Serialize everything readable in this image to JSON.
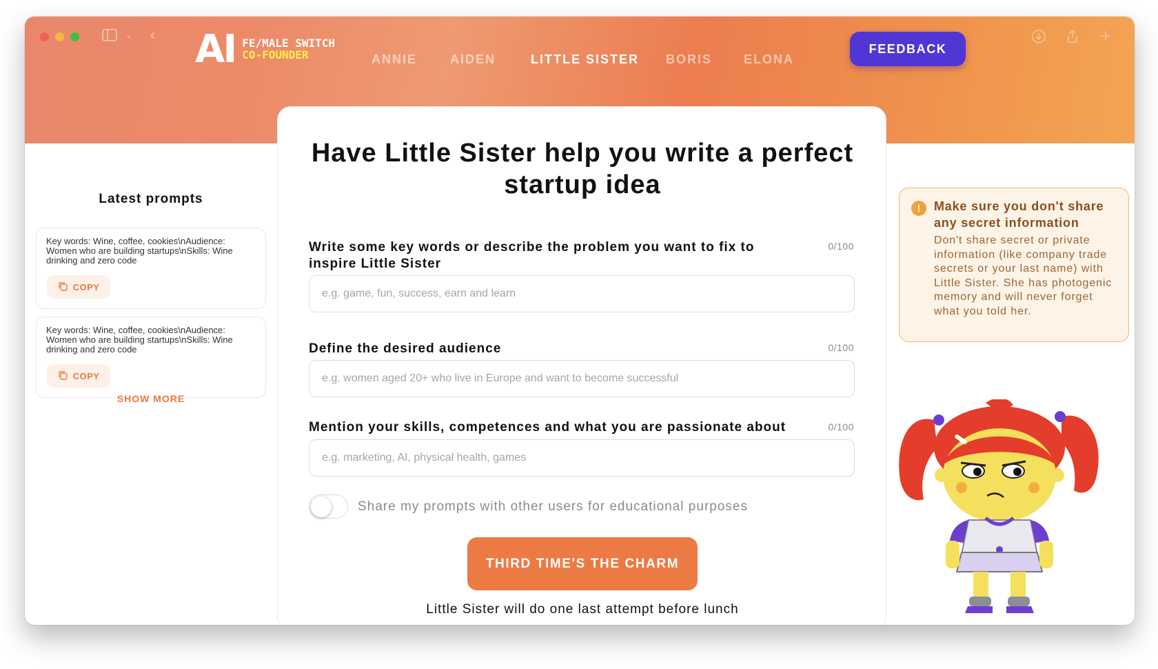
{
  "brand": {
    "logo_mark": "AI",
    "line1": "FE/MALE SWITCH",
    "line2": "CO-FOUNDER"
  },
  "nav": {
    "items": [
      "ANNIE",
      "AIDEN",
      "LITTLE SISTER",
      "BORIS",
      "ELONA"
    ],
    "active": "LITTLE SISTER",
    "feedback_label": "FEEDBACK"
  },
  "sidebar": {
    "title": "Latest prompts",
    "prompts": [
      {
        "text": "Key words: Wine, coffee, cookies\\nAudience: Women who are building startups\\nSkills: Wine drinking and zero code",
        "copy_label": "COPY"
      },
      {
        "text": "Key words: Wine, coffee, cookies\\nAudience: Women who are building startups\\nSkills: Wine drinking and zero code",
        "copy_label": "COPY"
      }
    ],
    "show_more_label": "SHOW MORE"
  },
  "form": {
    "title": "Have Little Sister help you write a perfect startup idea",
    "fields": [
      {
        "label": "Write some key words or describe the problem you want to fix to inspire Little Sister",
        "counter": "0/100",
        "placeholder": "e.g. game, fun, success, earn and learn",
        "value": ""
      },
      {
        "label": "Define the desired audience",
        "counter": "0/100",
        "placeholder": "e.g. women aged 20+ who live in Europe and want to become successful",
        "value": ""
      },
      {
        "label": "Mention your skills, competences and what you are passionate about",
        "counter": "0/100",
        "placeholder": "e.g. marketing, AI, physical health, games",
        "value": ""
      }
    ],
    "share_toggle_label": "Share my prompts with other users for educational purposes",
    "share_toggle_on": false,
    "submit_label": "THIRD TIME'S THE CHARM",
    "hint": "Little Sister will do one last attempt before lunch"
  },
  "warning": {
    "icon": "exclamation-icon",
    "title": "Make sure you don't share any secret information",
    "body": "Don't share secret or private information (like company trade secrets or your last name) with Little Sister. She has photogenic memory and will never forget what you told her."
  },
  "colors": {
    "accent": "#ec7a45",
    "feedback": "#5136d6",
    "warning_border": "#f0b96a"
  }
}
